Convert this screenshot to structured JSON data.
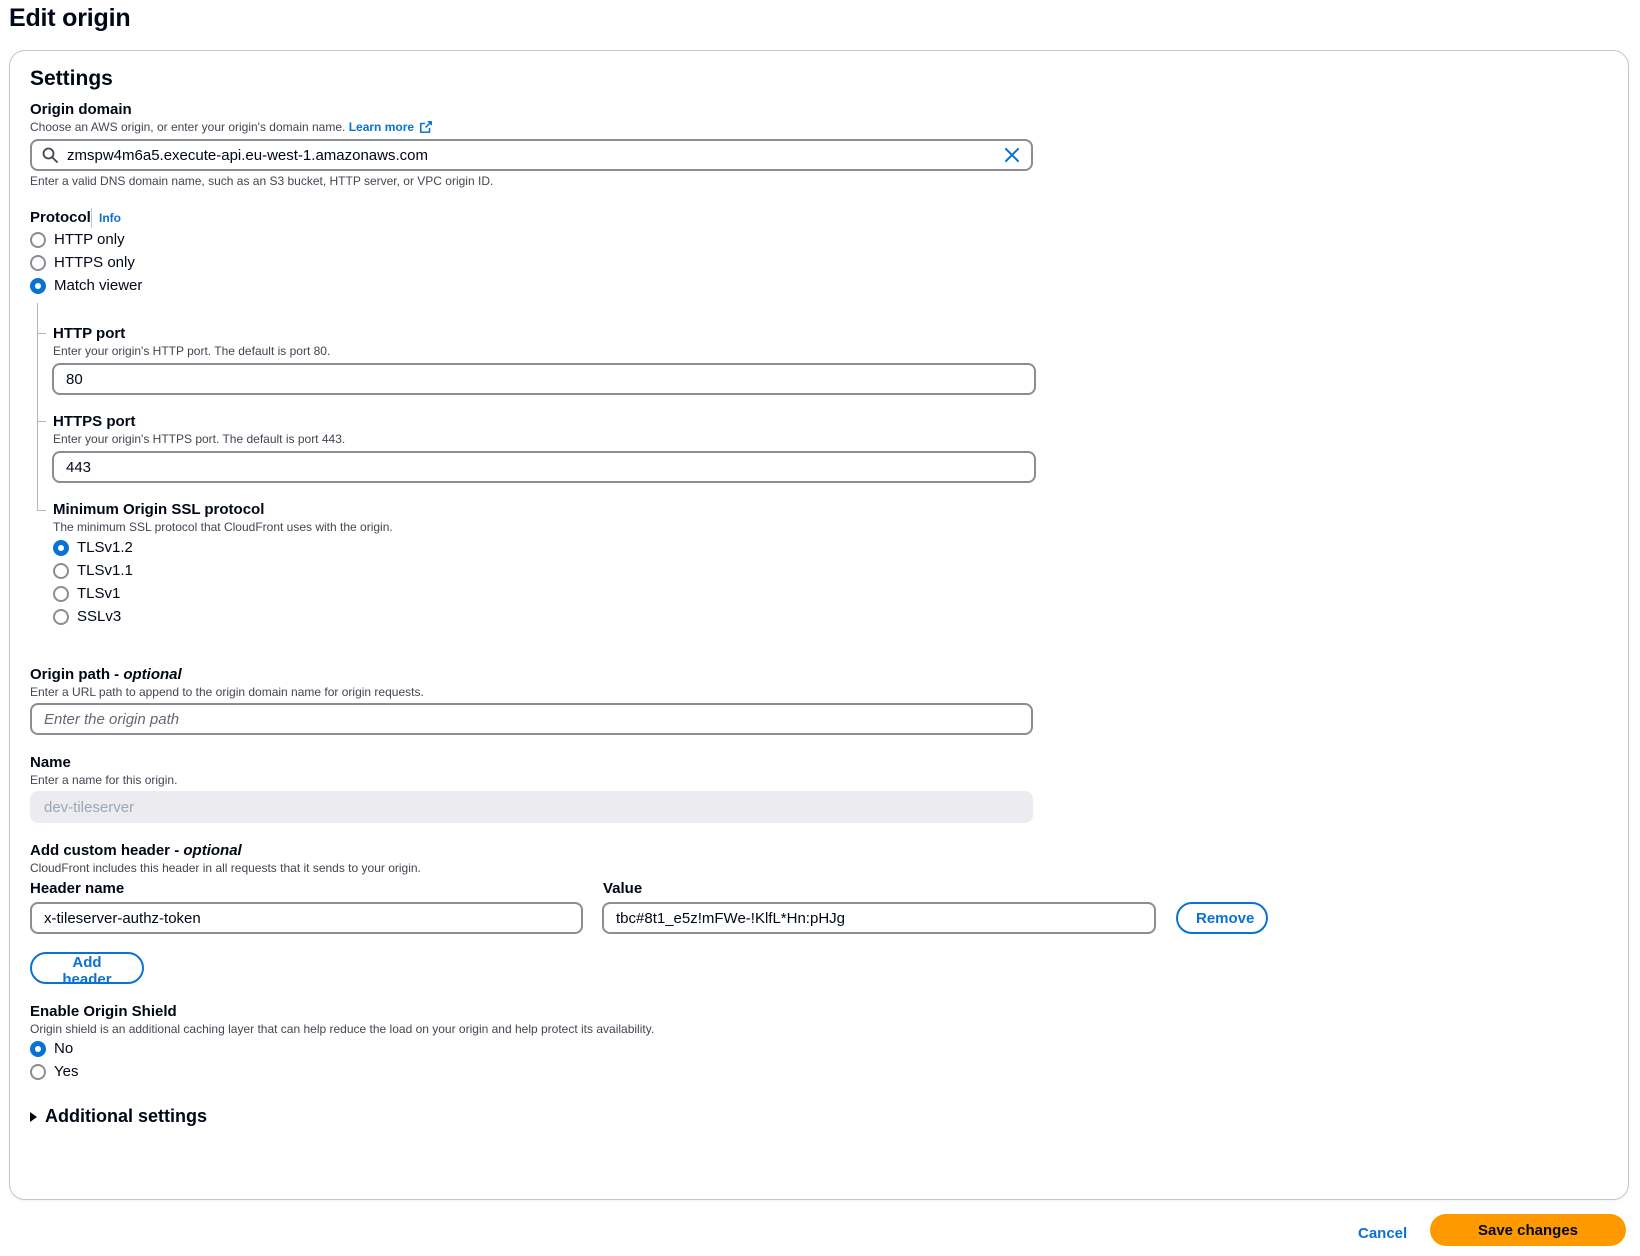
{
  "page": {
    "title": "Edit origin"
  },
  "settings": {
    "title": "Settings",
    "origin_domain": {
      "label": "Origin domain",
      "description": "Choose an AWS origin, or enter your origin's domain name.",
      "learn_more": "Learn more",
      "value": "zmspw4m6a5.execute-api.eu-west-1.amazonaws.com",
      "constraint": "Enter a valid DNS domain name, such as an S3 bucket, HTTP server, or VPC origin ID."
    },
    "protocol": {
      "label": "Protocol",
      "info": "Info",
      "options": [
        "HTTP only",
        "HTTPS only",
        "Match viewer"
      ],
      "selected": "Match viewer"
    },
    "http_port": {
      "label": "HTTP port",
      "description": "Enter your origin's HTTP port. The default is port 80.",
      "value": "80"
    },
    "https_port": {
      "label": "HTTPS port",
      "description": "Enter your origin's HTTPS port. The default is port 443.",
      "value": "443"
    },
    "min_ssl": {
      "label": "Minimum Origin SSL protocol",
      "description": "The minimum SSL protocol that CloudFront uses with the origin.",
      "options": [
        "TLSv1.2",
        "TLSv1.1",
        "TLSv1",
        "SSLv3"
      ],
      "selected": "TLSv1.2"
    },
    "origin_path": {
      "label": "Origin path",
      "optional": "optional",
      "description": "Enter a URL path to append to the origin domain name for origin requests.",
      "placeholder": "Enter the origin path",
      "value": ""
    },
    "name": {
      "label": "Name",
      "description": "Enter a name for this origin.",
      "value": "dev-tileserver"
    },
    "custom_header": {
      "label": "Add custom header",
      "optional": "optional",
      "description": "CloudFront includes this header in all requests that it sends to your origin.",
      "header_name_label": "Header name",
      "value_label": "Value",
      "header_name": "x-tileserver-authz-token",
      "header_value": "tbc#8t1_e5z!mFWe-!KlfL*Hn:pHJg",
      "remove_label": "Remove",
      "add_label": "Add header"
    },
    "origin_shield": {
      "label": "Enable Origin Shield",
      "description": "Origin shield is an additional caching layer that can help reduce the load on your origin and help protect its availability.",
      "options": [
        "No",
        "Yes"
      ],
      "selected": "No"
    },
    "additional_settings": {
      "label": "Additional settings"
    }
  },
  "footer": {
    "cancel_label": "Cancel",
    "save_label": "Save changes"
  },
  "colors": {
    "accent": "#0972d3",
    "primary": "#ff9900",
    "border": "#8c8c94"
  }
}
